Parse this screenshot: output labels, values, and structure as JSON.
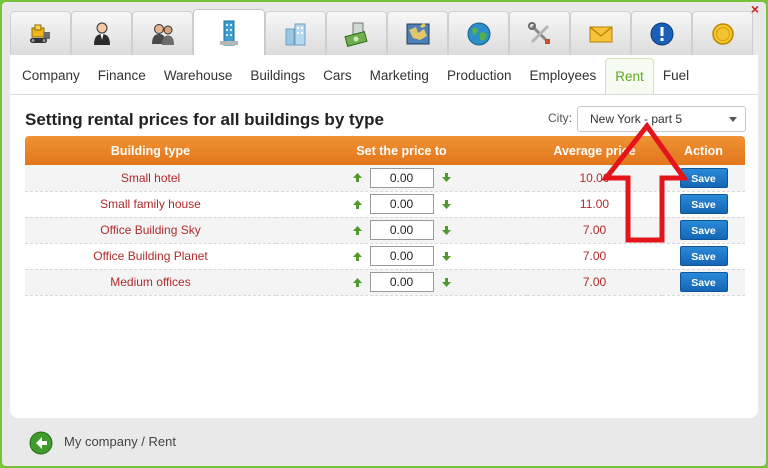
{
  "window": {
    "close_label": "×"
  },
  "icon_tabs": [
    {
      "icon": "bulldozer-icon"
    },
    {
      "icon": "manager-icon"
    },
    {
      "icon": "people-icon"
    },
    {
      "icon": "office-tower-icon",
      "active": true
    },
    {
      "icon": "buildings-icon"
    },
    {
      "icon": "money-icon"
    },
    {
      "icon": "map-icon"
    },
    {
      "icon": "globe-icon"
    },
    {
      "icon": "tools-icon"
    },
    {
      "icon": "envelope-icon"
    },
    {
      "icon": "alert-icon"
    },
    {
      "icon": "coin-icon"
    }
  ],
  "tabs": [
    {
      "label": "Company"
    },
    {
      "label": "Finance"
    },
    {
      "label": "Warehouse"
    },
    {
      "label": "Buildings"
    },
    {
      "label": "Cars"
    },
    {
      "label": "Marketing"
    },
    {
      "label": "Production"
    },
    {
      "label": "Employees"
    },
    {
      "label": "Rent",
      "active": true
    },
    {
      "label": "Fuel"
    }
  ],
  "page": {
    "title": "Setting rental prices for all buildings by type",
    "city_label": "City:",
    "city_value": "New York - part 5"
  },
  "table": {
    "headers": {
      "type": "Building type",
      "price": "Set the price to",
      "average": "Average price",
      "action": "Action"
    },
    "rows": [
      {
        "type": "Small hotel",
        "price": "0.00",
        "average": "10.00",
        "action": "Save"
      },
      {
        "type": "Small family house",
        "price": "0.00",
        "average": "11.00",
        "action": "Save"
      },
      {
        "type": "Office Building Sky",
        "price": "0.00",
        "average": "7.00",
        "action": "Save"
      },
      {
        "type": "Office Building Planet",
        "price": "0.00",
        "average": "7.00",
        "action": "Save"
      },
      {
        "type": "Medium offices",
        "price": "0.00",
        "average": "7.00",
        "action": "Save"
      }
    ]
  },
  "footer": {
    "breadcrumb": "My company / Rent"
  },
  "colors": {
    "accent_green": "#7cc43e",
    "header_orange": "#e98a2a",
    "save_blue": "#1a73c4",
    "value_red": "#b02a2a",
    "annotation_red": "#e4141b"
  }
}
